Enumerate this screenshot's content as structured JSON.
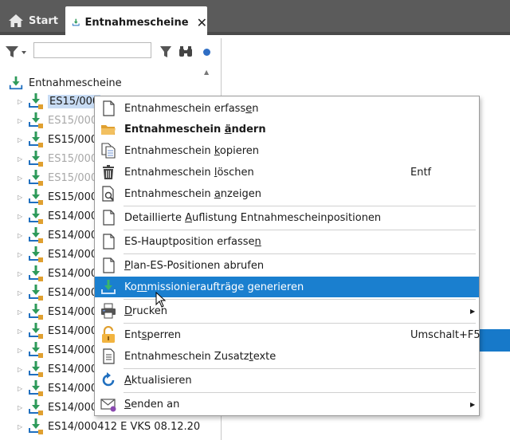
{
  "tabs": {
    "start_label": "Start",
    "active_label": "Entnahmescheine",
    "close_glyph": "✕"
  },
  "tree": {
    "root_label": "Entnahmescheine",
    "rows": [
      {
        "label": "ES15/000",
        "state": "selected"
      },
      {
        "label": "ES15/000",
        "state": "grey"
      },
      {
        "label": "ES15/000",
        "state": "normal"
      },
      {
        "label": "ES15/000",
        "state": "grey"
      },
      {
        "label": "ES15/000",
        "state": "grey"
      },
      {
        "label": "ES15/000",
        "state": "normal"
      },
      {
        "label": "ES14/000",
        "state": "normal"
      },
      {
        "label": "ES14/000",
        "state": "normal"
      },
      {
        "label": "ES14/000",
        "state": "normal"
      },
      {
        "label": "ES14/000",
        "state": "normal"
      },
      {
        "label": "ES14/000",
        "state": "normal"
      },
      {
        "label": "ES14/000",
        "state": "normal"
      },
      {
        "label": "ES14/000",
        "state": "normal"
      },
      {
        "label": "ES14/000",
        "state": "normal"
      },
      {
        "label": "ES14/000",
        "state": "normal"
      },
      {
        "label": "ES14/000",
        "state": "normal"
      },
      {
        "label": "ES14/000",
        "state": "normal"
      },
      {
        "label": "ES14/000412  E  VKS  08.12.20",
        "state": "normal"
      }
    ]
  },
  "menu": {
    "items": [
      {
        "pre": "Entnahmeschein erfass",
        "ul": "e",
        "post": "n",
        "short": ""
      },
      {
        "pre": "Entnahmeschein ",
        "ul": "ä",
        "post": "ndern",
        "short": ""
      },
      {
        "pre": "Entnahmeschein ",
        "ul": "k",
        "post": "opieren",
        "short": ""
      },
      {
        "pre": "Entnahmeschein ",
        "ul": "l",
        "post": "öschen",
        "short": "Entf"
      },
      {
        "pre": "Entnahmeschein ",
        "ul": "a",
        "post": "nzeigen",
        "short": ""
      },
      {
        "pre": "Detaillierte ",
        "ul": "A",
        "post": "uflistung Entnahmescheinpositionen",
        "short": ""
      },
      {
        "pre": "ES-Hauptposition erfasse",
        "ul": "n",
        "post": "",
        "short": ""
      },
      {
        "pre": "",
        "ul": "P",
        "post": "lan-ES-Positionen abrufen",
        "short": ""
      },
      {
        "pre": "Ko",
        "ul": "m",
        "post": "missionieraufträge generieren",
        "short": ""
      },
      {
        "pre": "",
        "ul": "D",
        "post": "rucken",
        "short": ""
      },
      {
        "pre": "Ent",
        "ul": "s",
        "post": "perren",
        "short": "Umschalt+F5"
      },
      {
        "pre": "Entnahmeschein Zusatz",
        "ul": "t",
        "post": "exte",
        "short": ""
      },
      {
        "pre": "",
        "ul": "A",
        "post": "ktualisieren",
        "short": ""
      },
      {
        "pre": "",
        "ul": "S",
        "post": "enden an",
        "short": ""
      }
    ],
    "submenu_arrow": "▶"
  },
  "icons": {
    "start": "house-icon",
    "entnahme": "download-arrow-icon",
    "filter": "funnel-icon",
    "search": "binoculars-icon"
  },
  "colors": {
    "accent": "#1a7fcf",
    "tree_green": "#2e9a5a",
    "selection": "#c8dcf4"
  }
}
